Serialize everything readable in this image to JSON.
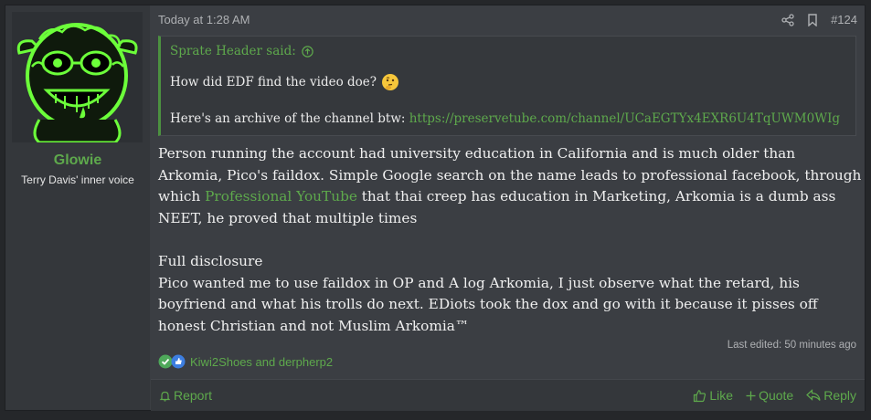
{
  "user": {
    "name": "Glowie",
    "title": "Terry Davis' inner voice"
  },
  "header": {
    "date": "Today at 1:28 AM",
    "post_number": "#124"
  },
  "quote": {
    "author_label": "Sprate Header said:",
    "line1": "How did EDF find the video doe?",
    "line2_prefix": "Here's an archive of the channel btw: ",
    "line2_link": "https://preservetube.com/channel/UCaEGTYx4EXR6U4TqUWM0WIg"
  },
  "body": {
    "p1_a": "Person running the account had university education in California and is much older than Arkomia, Pico's faildox. Simple Google search on the name leads to professional facebook, through which ",
    "p1_link": "Professional YouTube",
    "p1_b": " that thai creep has education in Marketing, Arkomia is a dumb ass NEET, he proved that multiple times",
    "p2": "Full disclosure",
    "p3": "Pico wanted me to use faildox in OP and A log Arkomia, I just observe what the retard, his boyfriend and what his trolls do next. EDiots took the dox and go with it because it pisses off honest Christian and not Muslim Arkomia™"
  },
  "edited": "Last edited: 50 minutes ago",
  "reactions": {
    "names": "Kiwi2Shoes and derpherp2"
  },
  "footer": {
    "report": "Report",
    "like": "Like",
    "quote": "Quote",
    "reply": "Reply"
  },
  "colors": {
    "accent": "#5ea94c",
    "background": "#3b3e43",
    "text": "#f0f0f0"
  }
}
